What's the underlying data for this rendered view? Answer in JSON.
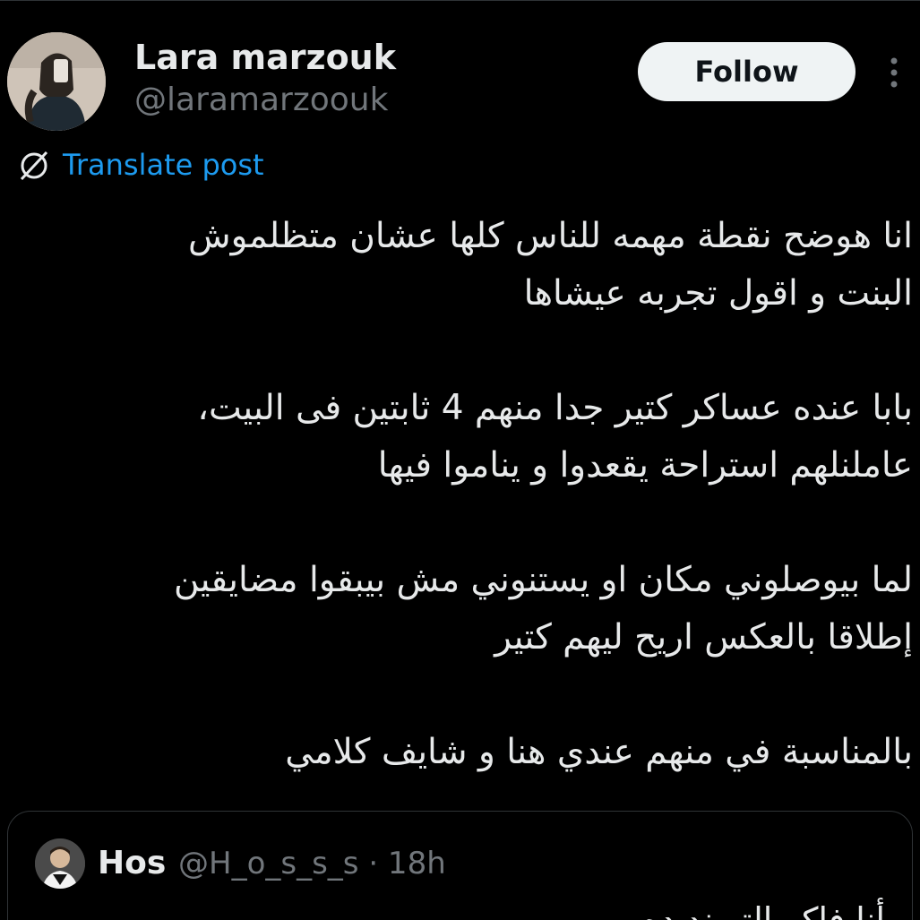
{
  "author": {
    "display_name": "Lara marzouk",
    "handle": "@laramarzoouk",
    "avatar_icon": "profile-photo"
  },
  "actions": {
    "follow_label": "Follow",
    "more_icon": "more-vertical-icon"
  },
  "translate": {
    "icon": "globe-icon",
    "label": "Translate post"
  },
  "post": {
    "paragraphs": [
      [
        "انا هوضح نقطة مهمه للناس كلها عشان متظلموش",
        "البنت و اقول تجربه عيشاها"
      ],
      [
        "بابا عنده عساكر كتير جدا منهم 4 ثابتين فى البيت،",
        "عاملنلهم استراحة يقعدوا و يناموا فيها"
      ],
      [
        "لما بيوصلوني مكان او يستنوني مش بيبقوا مضايقين",
        "إطلاقا بالعكس اريح ليهم كتير"
      ],
      [
        "بالمناسبة في منهم عندي هنا و شايف كلامي"
      ]
    ]
  },
  "quoted_post": {
    "display_name": "Hos",
    "meta": "@H_o_s_s_s · 18h",
    "snippet": "أنا فاكر التريند ده"
  },
  "colors": {
    "background": "#000000",
    "text": "#e7e9ea",
    "secondary_text": "#71767b",
    "link": "#1d9bf0",
    "follow_bg": "#eff3f4",
    "border": "#2f3336"
  }
}
